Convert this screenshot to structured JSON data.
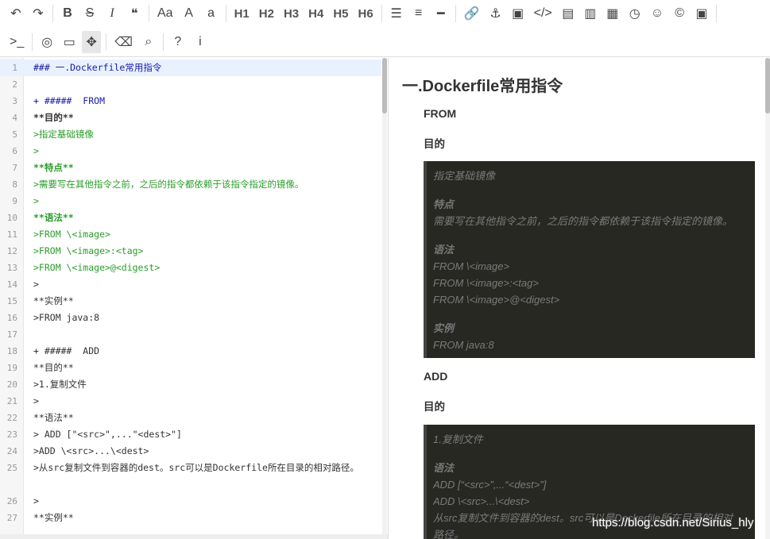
{
  "toolbar": {
    "row1": [
      {
        "name": "undo-icon",
        "glyph": "↶"
      },
      {
        "name": "redo-icon",
        "glyph": "↷"
      },
      {
        "name": "bold-icon",
        "glyph": "B"
      },
      {
        "name": "strikethrough-icon",
        "glyph": "S"
      },
      {
        "name": "italic-icon",
        "glyph": "I"
      },
      {
        "name": "quote-icon",
        "glyph": "❝"
      },
      {
        "name": "uppercase-icon",
        "glyph": "Aa"
      },
      {
        "name": "uppercase-a-icon",
        "glyph": "A"
      },
      {
        "name": "lowercase-a-icon",
        "glyph": "a"
      },
      {
        "name": "h1-button",
        "glyph": "H1"
      },
      {
        "name": "h2-button",
        "glyph": "H2"
      },
      {
        "name": "h3-button",
        "glyph": "H3"
      },
      {
        "name": "h4-button",
        "glyph": "H4"
      },
      {
        "name": "h5-button",
        "glyph": "H5"
      },
      {
        "name": "h6-button",
        "glyph": "H6"
      },
      {
        "name": "unordered-list-icon",
        "glyph": "☰"
      },
      {
        "name": "ordered-list-icon",
        "glyph": "≡"
      },
      {
        "name": "horizontal-rule-icon",
        "glyph": "━"
      },
      {
        "name": "link-icon",
        "glyph": "🔗"
      },
      {
        "name": "anchor-icon",
        "glyph": "⚓"
      },
      {
        "name": "image-icon",
        "glyph": "▣"
      },
      {
        "name": "code-icon",
        "glyph": "</>"
      },
      {
        "name": "code-block-icon",
        "glyph": "▤"
      },
      {
        "name": "code-file-icon",
        "glyph": "▥"
      },
      {
        "name": "table-icon",
        "glyph": "▦"
      },
      {
        "name": "clock-icon",
        "glyph": "◷"
      },
      {
        "name": "emoji-icon",
        "glyph": "☺"
      },
      {
        "name": "copyright-icon",
        "glyph": "©"
      },
      {
        "name": "html-entities-icon",
        "glyph": "▣"
      }
    ],
    "row2": [
      {
        "name": "terminal-icon",
        "glyph": ">_"
      },
      {
        "name": "eye-slash-icon",
        "glyph": "◎"
      },
      {
        "name": "desktop-icon",
        "glyph": "▭"
      },
      {
        "name": "fullscreen-icon",
        "glyph": "✥"
      },
      {
        "name": "eraser-icon",
        "glyph": "⌫"
      },
      {
        "name": "search-icon",
        "glyph": "⌕"
      },
      {
        "name": "help-icon",
        "glyph": "?"
      },
      {
        "name": "info-icon",
        "glyph": "i"
      }
    ]
  },
  "editor": {
    "lines": [
      {
        "n": "1",
        "text": "### 一.Dockerfile常用指令",
        "cls": "c-head"
      },
      {
        "n": "2",
        "text": "",
        "cls": ""
      },
      {
        "n": "3",
        "text": "+ #####  FROM",
        "cls": "c-blue"
      },
      {
        "n": "4",
        "text": "**目的**",
        "cls": "c-bold"
      },
      {
        "n": "5",
        "text": ">指定基础镜像",
        "cls": "c-green"
      },
      {
        "n": "6",
        "text": ">",
        "cls": "c-green"
      },
      {
        "n": "7",
        "text": "**特点**",
        "cls": "c-green c-bold"
      },
      {
        "n": "8",
        "text": ">需要写在其他指令之前，之后的指令都依赖于该指令指定的镜像。",
        "cls": "c-green"
      },
      {
        "n": "9",
        "text": ">",
        "cls": "c-green"
      },
      {
        "n": "10",
        "text": "**语法**",
        "cls": "c-green c-bold"
      },
      {
        "n": "11",
        "text": ">FROM \\<image>",
        "cls": "c-green"
      },
      {
        "n": "12",
        "text": ">FROM \\<image>:<tag>",
        "cls": "c-green"
      },
      {
        "n": "13",
        "text": ">FROM \\<image>@<digest>",
        "cls": "c-green"
      },
      {
        "n": "14",
        "text": ">",
        "cls": ""
      },
      {
        "n": "15",
        "text": "**实例**",
        "cls": ""
      },
      {
        "n": "16",
        "text": ">FROM java:8",
        "cls": ""
      },
      {
        "n": "17",
        "text": "",
        "cls": ""
      },
      {
        "n": "18",
        "text": "+ #####  ADD",
        "cls": ""
      },
      {
        "n": "19",
        "text": "**目的**",
        "cls": ""
      },
      {
        "n": "20",
        "text": ">1.复制文件",
        "cls": ""
      },
      {
        "n": "21",
        "text": ">",
        "cls": ""
      },
      {
        "n": "22",
        "text": "**语法**",
        "cls": ""
      },
      {
        "n": "23",
        "text": "> ADD [\"<src>\",...\"<dest>\"]",
        "cls": ""
      },
      {
        "n": "24",
        "text": ">ADD \\<src>...\\<dest>",
        "cls": ""
      },
      {
        "n": "25",
        "text": ">从src复制文件到容器的dest。src可以是Dockerfile所在目录的相对路径。",
        "cls": "",
        "tall": true
      },
      {
        "n": "26",
        "text": ">",
        "cls": ""
      },
      {
        "n": "27",
        "text": "**实例**",
        "cls": ""
      }
    ]
  },
  "preview": {
    "h3": "一.Dockerfile常用指令",
    "from_heading": "FROM",
    "from_goal": "目的",
    "from_quote": [
      {
        "t": "指定基础镜像"
      },
      {
        "gap": true
      },
      {
        "t": "特点",
        "strong": true
      },
      {
        "t": "需要写在其他指令之前，之后的指令都依赖于该指令指定的镜像。"
      },
      {
        "gap": true
      },
      {
        "t": "语法",
        "strong": true
      },
      {
        "t": "FROM \\<image>"
      },
      {
        "t": "FROM \\<image>:<tag>"
      },
      {
        "t": "FROM \\<image>@<digest>"
      },
      {
        "gap": true
      },
      {
        "t": "实例",
        "strong": true
      },
      {
        "t": "FROM java:8"
      }
    ],
    "add_heading": "ADD",
    "add_goal": "目的",
    "add_quote": [
      {
        "t": "1.复制文件"
      },
      {
        "gap": true
      },
      {
        "t": "语法",
        "strong": true
      },
      {
        "t": "ADD [“<src>”,...“<dest>”]"
      },
      {
        "t": "ADD \\<src>...\\<dest>"
      },
      {
        "t": "从src复制文件到容器的dest。src可以是Dockerfile所在目录的相对"
      },
      {
        "t": "路径。"
      }
    ]
  },
  "watermark": "https://blog.csdn.net/Sirius_hly"
}
